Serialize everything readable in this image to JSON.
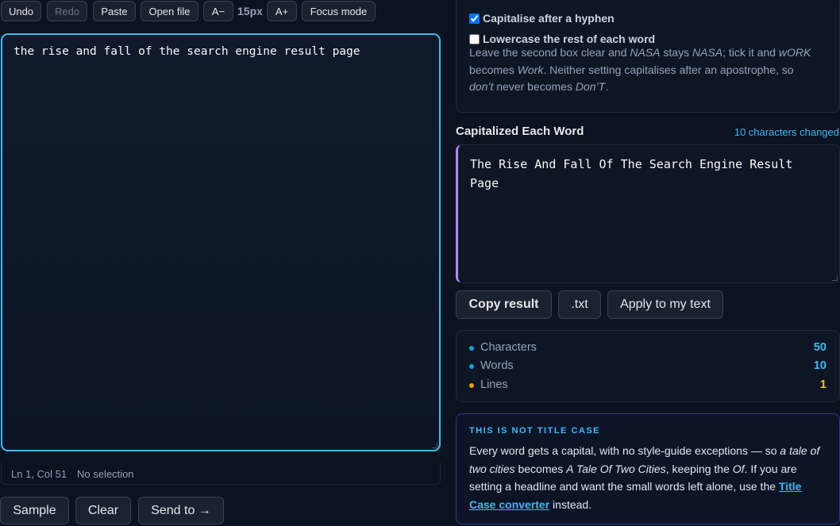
{
  "toolbar": {
    "undo": "Undo",
    "redo": "Redo",
    "paste": "Paste",
    "open_file": "Open file",
    "font_decrease": "A−",
    "font_size": "15px",
    "font_increase": "A+",
    "focus_mode": "Focus mode"
  },
  "editor": {
    "text": "the rise and fall of the search engine result page",
    "status_position": "Ln 1, Col 51",
    "status_selection": "No selection"
  },
  "bottom_actions": {
    "sample": "Sample",
    "clear": "Clear",
    "send_to": "Send to →"
  },
  "options": {
    "hyphen_label": "Capitalise after a hyphen",
    "hyphen_checked": true,
    "lowercase_label": "Lowercase the rest of each word",
    "lowercase_checked": false,
    "help": {
      "p1": "Leave the second box clear and ",
      "e1": "NASA",
      "p2": " stays ",
      "e2": "NASA",
      "p3": "; tick it and ",
      "e3": "wORK",
      "p4": " becomes ",
      "e4": "Work",
      "p5": ". Neither setting capitalises after an apostrophe, so ",
      "e5": "don’t",
      "p6": " never becomes ",
      "e6": "Don’T",
      "p7": "."
    }
  },
  "result": {
    "title": "Capitalized Each Word",
    "changed": "10 characters changed",
    "text": "The Rise And Fall Of The Search Engine Result Page",
    "copy": "Copy result",
    "txt": ".txt",
    "apply": "Apply to my text"
  },
  "stats": [
    {
      "label": "Characters",
      "value": "50",
      "color": "#38bdf8",
      "dot": "#0ea5e9"
    },
    {
      "label": "Words",
      "value": "10",
      "color": "#38bdf8",
      "dot": "#0ea5e9"
    },
    {
      "label": "Lines",
      "value": "1",
      "color": "#fbbf24",
      "dot": "#f59e0b"
    }
  ],
  "note": {
    "heading": "THIS IS NOT TITLE CASE",
    "p1": "Every word gets a capital, with no style-guide exceptions — so ",
    "e1": "a tale of two cities",
    "p2": " becomes ",
    "e2": "A Tale Of Two Cities",
    "p3": ", keeping the ",
    "e3": "Of",
    "p4": ". If you are setting a headline and want the small words left alone, use the ",
    "link": "Title Case converter",
    "p5": " instead."
  }
}
